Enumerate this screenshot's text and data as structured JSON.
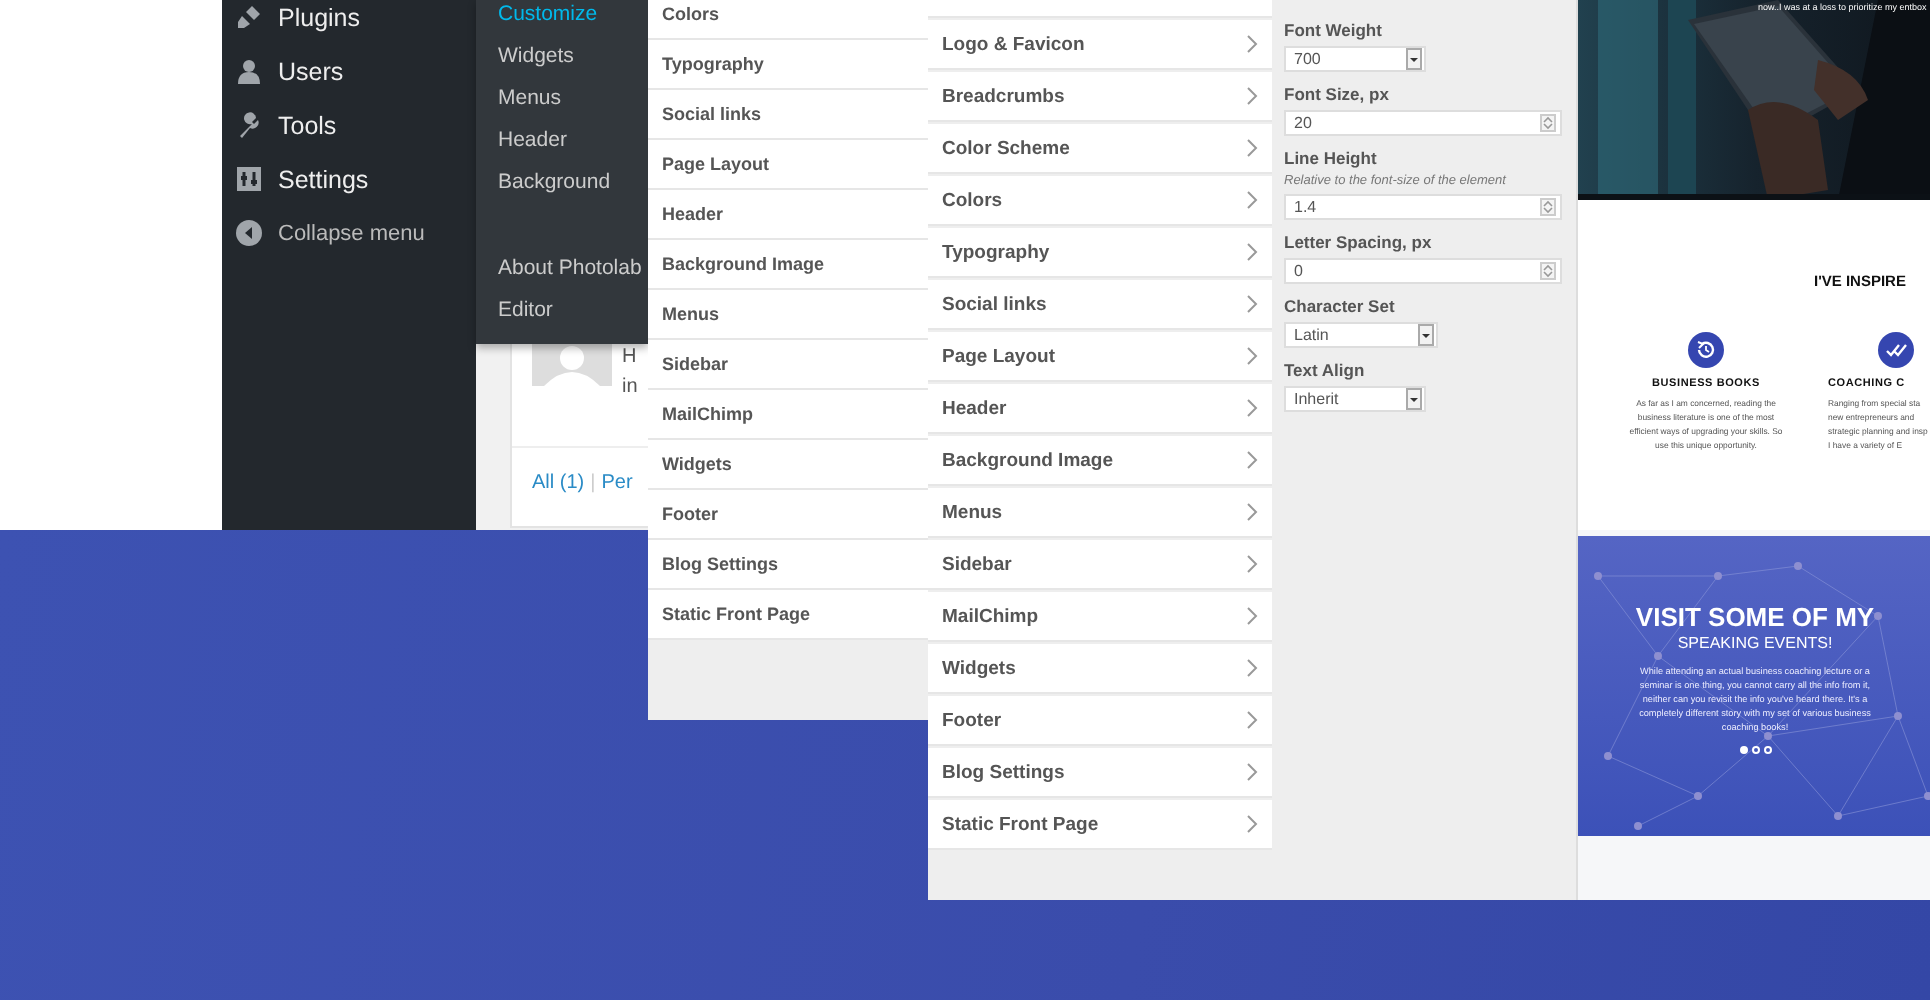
{
  "admin": {
    "menu": [
      {
        "label": "Plugins"
      },
      {
        "label": "Users"
      },
      {
        "label": "Tools"
      },
      {
        "label": "Settings"
      }
    ],
    "collapse": "Collapse menu",
    "submenu_groups": [
      {
        "items": [
          {
            "label": "Customize",
            "selected": true
          },
          {
            "label": "Widgets",
            "selected": false
          },
          {
            "label": "Menus",
            "selected": false
          },
          {
            "label": "Header",
            "selected": false
          },
          {
            "label": "Background",
            "selected": false
          }
        ]
      },
      {
        "items": [
          {
            "label": "About Photolab",
            "selected": false
          },
          {
            "label": "Editor",
            "selected": false
          }
        ]
      }
    ],
    "card": {
      "line_1": "H",
      "line_2": "in",
      "filter": "All (1)",
      "separator": "|",
      "filter_2": "Per"
    }
  },
  "customizer_back": {
    "sections": [
      "Colors",
      "Typography",
      "Social links",
      "Page Layout",
      "Header",
      "Background Image",
      "Menus",
      "Sidebar",
      "MailChimp",
      "Widgets",
      "Footer",
      "Blog Settings",
      "Static Front Page"
    ]
  },
  "customizer": {
    "sections": [
      "Logo & Favicon",
      "Breadcrumbs",
      "Color Scheme",
      "Colors",
      "Typography",
      "Social links",
      "Page Layout",
      "Header",
      "Background Image",
      "Menus",
      "Sidebar",
      "MailChimp",
      "Widgets",
      "Footer",
      "Blog Settings",
      "Static Front Page"
    ],
    "fields": [
      {
        "kind": "select",
        "label": "Font Weight",
        "value": "700"
      },
      {
        "kind": "number",
        "label": "Font Size, px",
        "value": "20"
      },
      {
        "kind": "number",
        "label": "Line Height",
        "hint": "Relative to the font-size of the element",
        "value": "1.4"
      },
      {
        "kind": "number",
        "label": "Letter Spacing, px",
        "value": "0"
      },
      {
        "kind": "select",
        "label": "Character Set",
        "value": "Latin"
      },
      {
        "kind": "select",
        "label": "Text Align",
        "value": "Inherit"
      }
    ]
  },
  "preview": {
    "caption": "now..I was at a loss to prioritize my entbox",
    "heading": "I'VE INSPIRE",
    "features": [
      {
        "title": "BUSINESS BOOKS",
        "lines": [
          "As far as I am concerned, reading the",
          "business literature is one of the most",
          "efficient ways of upgrading your skills. So",
          "use this unique opportunity."
        ]
      },
      {
        "title": "COACHING C",
        "lines": [
          "Ranging from special sta",
          "new entrepreneurs and",
          "strategic planning and insp",
          "I have a variety of E"
        ]
      }
    ],
    "banner": {
      "title": "VISIT SOME OF MY",
      "subtitle": "SPEAKING EVENTS!",
      "text": "While attending an actual business coaching lecture or a seminar is one thing, you cannot carry all the info from it, neither can you revisit the info you've heard there. It's a completely different story with my set of various business coaching books!",
      "dots": [
        {
          "selected": true
        },
        {
          "selected": false
        },
        {
          "selected": false
        }
      ]
    }
  }
}
